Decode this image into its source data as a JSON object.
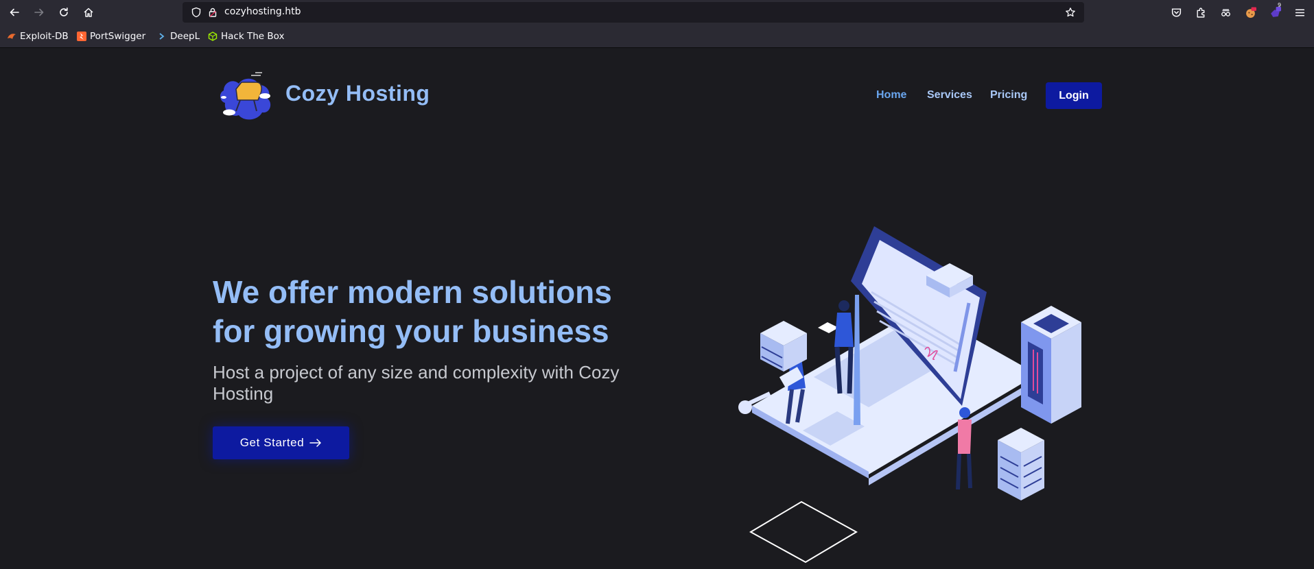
{
  "browser": {
    "url": "cozyhosting.htb",
    "bookmarks": [
      {
        "label": "Exploit-DB",
        "icon": "exploitdb-icon"
      },
      {
        "label": "PortSwigger",
        "icon": "portswigger-icon"
      },
      {
        "label": "DeepL",
        "icon": "deepl-icon"
      },
      {
        "label": "Hack The Box",
        "icon": "hackthebox-icon"
      }
    ],
    "extension_badge": "9"
  },
  "site": {
    "brand": "Cozy Hosting",
    "nav": {
      "home": "Home",
      "services": "Services",
      "pricing": "Pricing",
      "login": "Login"
    }
  },
  "hero": {
    "title": "We offer modern solutions for growing your business",
    "subtitle": "Host a project of any size and complexity with Cozy Hosting",
    "cta": "Get Started"
  },
  "colors": {
    "accent": "#0d1aa0",
    "heading": "#94bdf6",
    "background": "#1b1b1f"
  }
}
